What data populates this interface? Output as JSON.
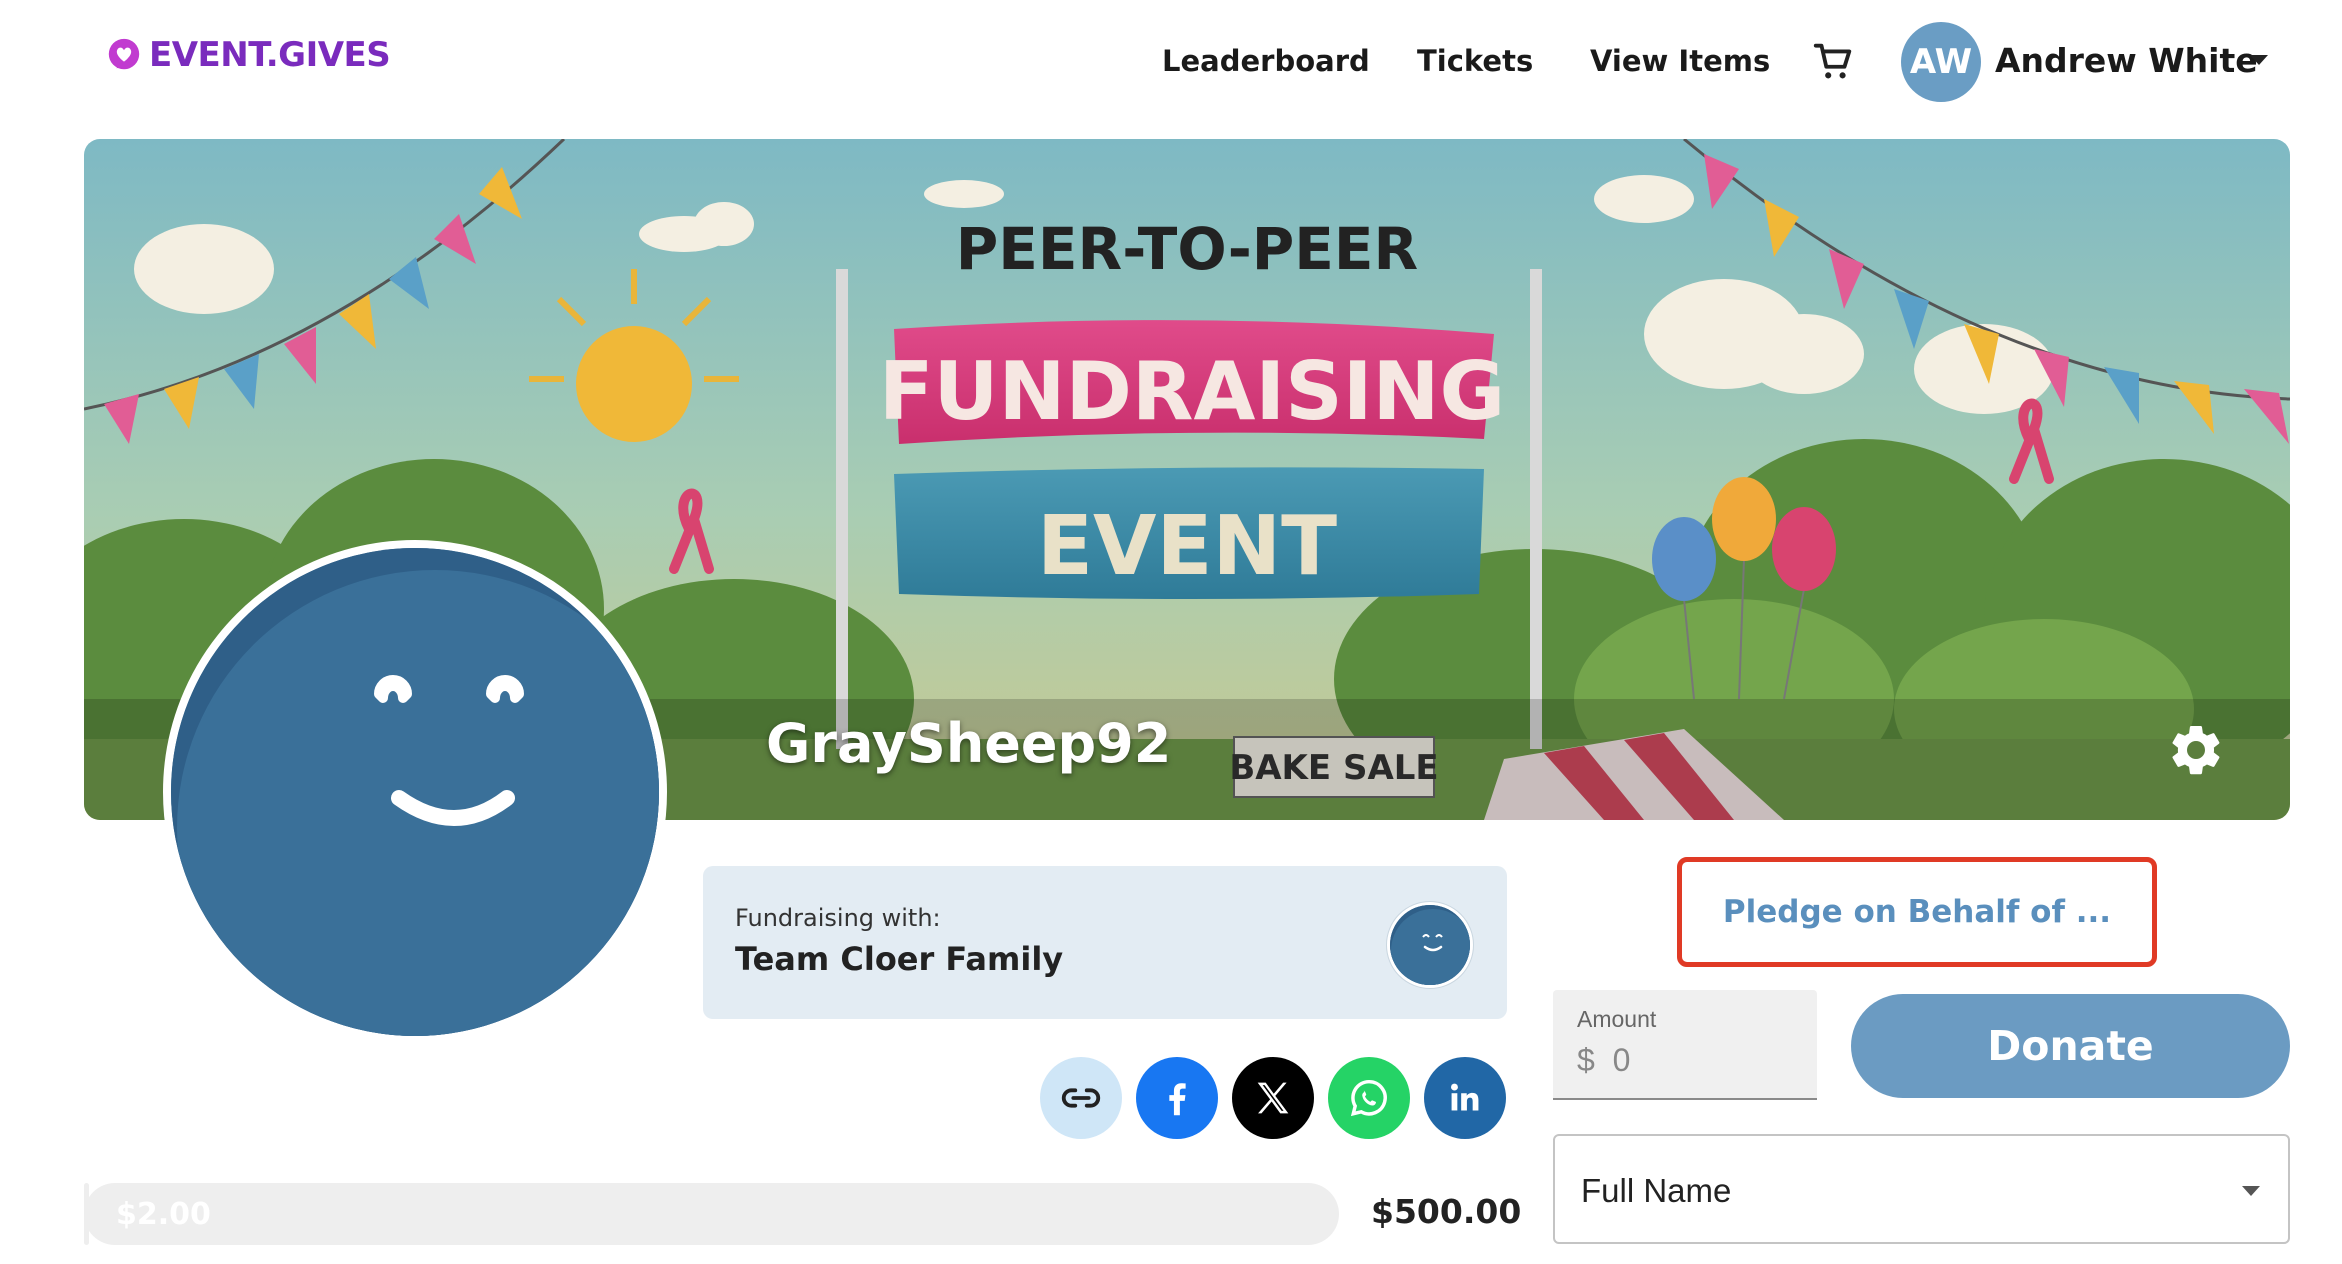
{
  "brand": {
    "name": "EVENT.GIVES",
    "color": "#7a2bbd"
  },
  "nav": {
    "leaderboard": "Leaderboard",
    "tickets": "Tickets",
    "view_items": "View Items",
    "cart_icon": "cart-icon"
  },
  "user": {
    "initials": "AW",
    "name": "Andrew White"
  },
  "banner": {
    "line1": "PEER-TO-PEER",
    "line2": "FUNDRAISING",
    "line3": "EVENT",
    "sign": "BAKE SALE"
  },
  "profile": {
    "username": "GraySheep92"
  },
  "team": {
    "label": "Fundraising with:",
    "name": "Team Cloer Family"
  },
  "share": [
    "link-icon",
    "facebook-icon",
    "x-icon",
    "whatsapp-icon",
    "linkedin-icon"
  ],
  "progress": {
    "raised": "$2.00",
    "goal": "$500.00",
    "fraction": 0.004
  },
  "donation": {
    "pledge_label": "Pledge on Behalf of ...",
    "amount_label": "Amount",
    "currency": "$",
    "amount_value": "0",
    "donate_label": "Donate",
    "name_select": "Full Name"
  },
  "colors": {
    "accent": "#6b9bc2",
    "highlight": "#e03a25",
    "avatar": "#3a7099"
  }
}
